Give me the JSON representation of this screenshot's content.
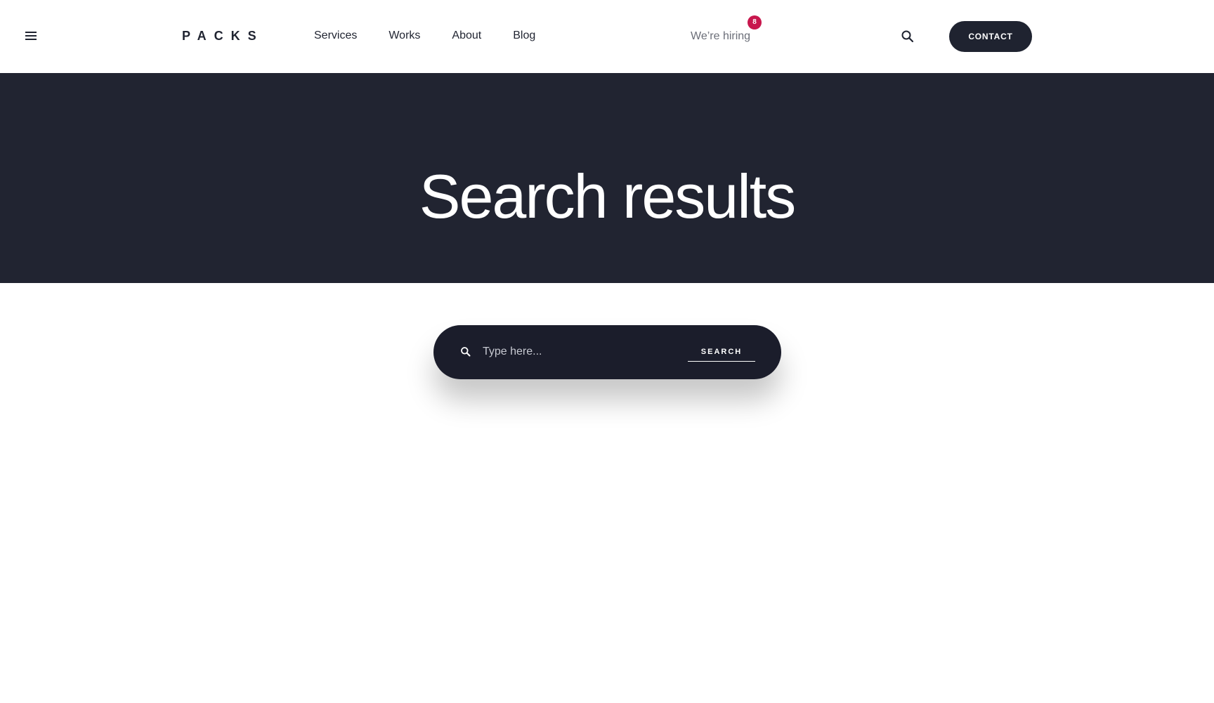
{
  "header": {
    "menu_icon": "hamburger-menu-icon",
    "logo": "PACKS",
    "nav": [
      {
        "label": "Services"
      },
      {
        "label": "Works"
      },
      {
        "label": "About"
      },
      {
        "label": "Blog"
      }
    ],
    "hiring": {
      "label": "We’re hiring",
      "badge_count": "8",
      "badge_color": "#c8174d"
    },
    "search_icon": "search-icon",
    "contact_label": "CONTACT"
  },
  "hero": {
    "title": "Search results",
    "background": "#212431"
  },
  "search": {
    "placeholder": "Type here...",
    "value": "",
    "submit_label": "SEARCH",
    "icon": "search-icon"
  }
}
